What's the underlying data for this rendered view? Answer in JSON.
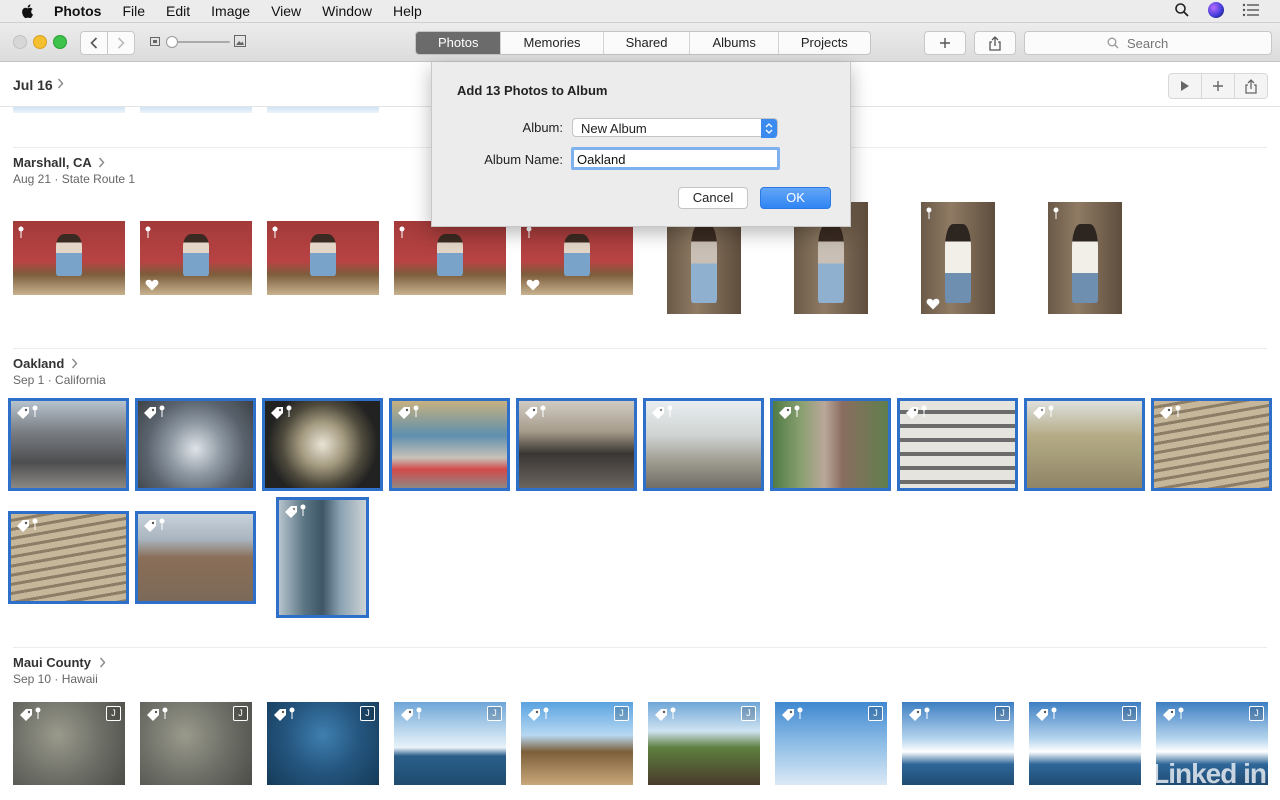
{
  "menubar": {
    "app_name": "Photos",
    "items": [
      "File",
      "Edit",
      "Image",
      "View",
      "Window",
      "Help"
    ]
  },
  "toolbar": {
    "tabs": [
      "Photos",
      "Memories",
      "Shared",
      "Albums",
      "Projects"
    ],
    "active_tab": "Photos",
    "search_placeholder": "Search"
  },
  "subheader": {
    "title": "Jul 16"
  },
  "moments": [
    {
      "title": "Marshall, CA",
      "date": "Aug 21",
      "location": "State Route 1"
    },
    {
      "title": "Oakland",
      "date": "Sep 1",
      "location": "California"
    },
    {
      "title": "Maui County",
      "date": "Sep 10",
      "location": "Hawaii"
    }
  ],
  "dialog": {
    "title": "Add 13 Photos to Album",
    "album_label": "Album:",
    "album_value": "New Album",
    "name_label": "Album Name:",
    "name_value": "Oakland",
    "cancel_label": "Cancel",
    "ok_label": "OK"
  },
  "live_badge": "J",
  "watermark": "Linked in",
  "colors": {
    "selection": "#2e6fc9",
    "accent": "#2f85f3"
  }
}
